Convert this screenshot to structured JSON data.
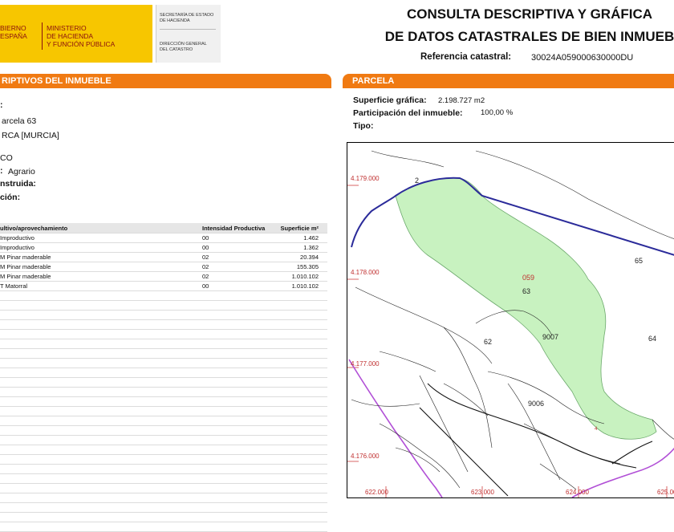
{
  "header": {
    "gov_line1": "BIERNO",
    "gov_line2": "ESPAÑA",
    "ministry_line1": "MINISTERIO",
    "ministry_line2": "DE HACIENDA",
    "ministry_line3": "Y FUNCIÓN PÚBLICA",
    "secretaria_line1": "SECRETARÍA DE ESTADO",
    "secretaria_line2": "DE HACIENDA",
    "direccion_line1": "DIRECCIÓN GENERAL",
    "direccion_line2": "DEL CATASTRO",
    "title_line1": "CONSULTA DESCRIPTIVA Y GRÁFICA",
    "title_line2": "DE DATOS CATASTRALES DE BIEN INMUEB",
    "ref_label": "Referencia catastral:",
    "ref_value": "30024A059000630000DU",
    "logo_color": "#f7c600"
  },
  "left": {
    "section_title": "RIPTIVOS DEL INMUEBLE",
    "rows": [
      {
        "label": ":",
        "value": ""
      },
      {
        "label": "",
        "value": "arcela 63"
      },
      {
        "label": "",
        "value": "RCA [MURCIA]"
      },
      {
        "label": "",
        "value": "CO"
      },
      {
        "label": "",
        "value": "Agrario"
      },
      {
        "label": "nstruida:",
        "value": ""
      },
      {
        "label": "ción:",
        "value": ""
      }
    ],
    "uso_prefix": ":"
  },
  "table": {
    "headers": [
      "ultivo/aprovechamiento",
      "Intensidad Productiva",
      "Superficie m²"
    ],
    "rows": [
      [
        "Improductivo",
        "00",
        "1.462"
      ],
      [
        "Improductivo",
        "00",
        "1.362"
      ],
      [
        "M Pinar maderable",
        "02",
        "20.394"
      ],
      [
        "M Pinar maderable",
        "02",
        "155.305"
      ],
      [
        "M Pinar maderable",
        "02",
        "1.010.102"
      ],
      [
        "T Matorral",
        "00",
        "1.010.102"
      ]
    ]
  },
  "right": {
    "section_title": "PARCELA",
    "superficie_label": "Superficie gráfica:",
    "superficie_value": "2.198.727 m2",
    "participacion_label": "Participación del inmueble:",
    "participacion_value": "100,00 %",
    "tipo_label": "Tipo:"
  },
  "map": {
    "y_labels": [
      "4.179.000",
      "4.178.000",
      "4.177.000",
      "4.176.000"
    ],
    "x_labels": [
      "622.000",
      "623.000",
      "624.000",
      "625.000"
    ],
    "parcel_labels": [
      "2",
      "65",
      "059",
      "63",
      "62",
      "9007",
      "64",
      "9006",
      "4"
    ],
    "parcel_fill": "#c8f2c0",
    "boundary_color": "#2b2b9a",
    "limit_color": "#b14fd6",
    "grid_color": "#d04040"
  }
}
